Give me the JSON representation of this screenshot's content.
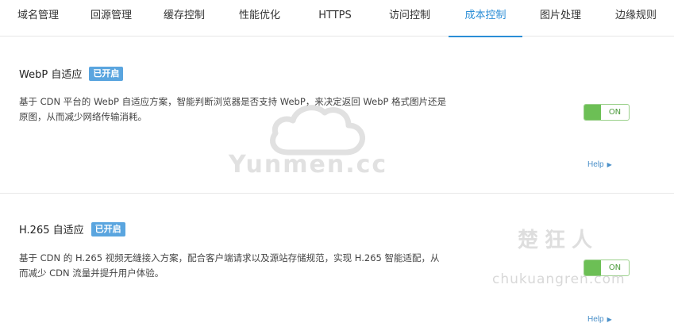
{
  "tabs": [
    {
      "label": "域名管理",
      "active": false
    },
    {
      "label": "回源管理",
      "active": false
    },
    {
      "label": "缓存控制",
      "active": false
    },
    {
      "label": "性能优化",
      "active": false
    },
    {
      "label": "HTTPS",
      "active": false
    },
    {
      "label": "访问控制",
      "active": false
    },
    {
      "label": "成本控制",
      "active": true
    },
    {
      "label": "图片处理",
      "active": false
    },
    {
      "label": "边缘规则",
      "active": false
    }
  ],
  "features": [
    {
      "title": "WebP 自适应",
      "badge": "已开启",
      "description_line1": "基于 CDN 平台的 WebP 自适应方案，智能判断浏览器是否支持 WebP，来决定返回 WebP 格式图片还是",
      "description_line2": "原图，从而减少网络传输消耗。",
      "toggle": "ON",
      "help": "Help"
    },
    {
      "title": "H.265 自适应",
      "badge": "已开启",
      "description_line1": "基于 CDN 的 H.265 视频无缝接入方案，配合客户端请求以及源站存储规范，实现 H.265 智能适配，从",
      "description_line2": "而减少 CDN 流量并提升用户体验。",
      "toggle": "ON",
      "help": "Help"
    }
  ],
  "watermarks": {
    "yunmen": "Yunmen.cc",
    "chukuangren_cn": "楚狂人",
    "chukuangren": "chukuangren.com"
  },
  "colors": {
    "accent": "#2b8ed6",
    "badge": "#5aa5df",
    "toggle_on": "#6cbf55",
    "help": "#4a90c9"
  },
  "icons": {
    "help_arrow": "triangle-right-icon",
    "watermark": "cloud-icon"
  }
}
